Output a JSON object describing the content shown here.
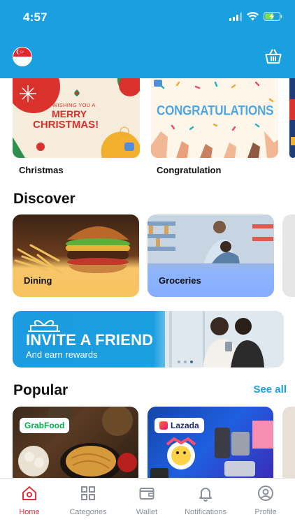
{
  "status_bar": {
    "time": "4:57"
  },
  "header": {
    "flag_icon": "singapore-flag-icon",
    "cart_icon": "basket-icon"
  },
  "occasions": [
    {
      "label": "Christmas",
      "art_text_1": "WISHING YOU A",
      "art_text_2": "MERRY",
      "art_text_3": "CHRISTMAS!"
    },
    {
      "label": "Congratulation",
      "art_text_1": "CONGRATULATIONS"
    }
  ],
  "discover": {
    "title": "Discover",
    "items": [
      {
        "label": "Dining"
      },
      {
        "label": "Groceries"
      }
    ]
  },
  "invite_banner": {
    "title": "INVITE A FRIEND",
    "subtitle": "And earn rewards"
  },
  "popular": {
    "title": "Popular",
    "see_all": "See all",
    "items": [
      {
        "brand": "GrabFood"
      },
      {
        "brand": "Lazada"
      }
    ]
  },
  "tabs": [
    {
      "label": "Home",
      "icon": "home-icon",
      "active": true
    },
    {
      "label": "Categories",
      "icon": "grid-icon",
      "active": false
    },
    {
      "label": "Wallet",
      "icon": "wallet-icon",
      "active": false
    },
    {
      "label": "Notifications",
      "icon": "bell-icon",
      "active": false
    },
    {
      "label": "Profile",
      "icon": "profile-icon",
      "active": false
    }
  ],
  "colors": {
    "header": "#1a9fe0",
    "accent_active": "#e0323c",
    "see_all": "#1a9fe0"
  }
}
